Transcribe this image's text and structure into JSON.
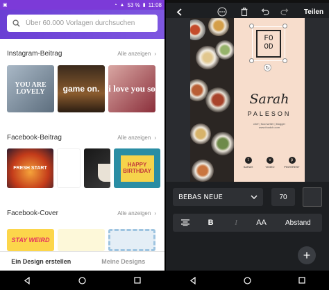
{
  "left_phone": {
    "status": {
      "battery": "53 %",
      "time": "11:08"
    },
    "search": {
      "placeholder": "Über 60.000 Vorlagen durchsuchen"
    },
    "sections": [
      {
        "title": "Instagram-Beitrag",
        "link": "Alle anzeigen",
        "thumbs": [
          "YOU ARE LOVELY",
          "game on.",
          "i love you so"
        ]
      },
      {
        "title": "Facebook-Beitrag",
        "link": "Alle anzeigen",
        "thumbs": [
          "FRESH START",
          "",
          "",
          "HAPPY BIRTHDAY"
        ]
      },
      {
        "title": "Facebook-Cover",
        "link": "Alle anzeigen",
        "thumbs": [
          "STAY WEIRD",
          "",
          ""
        ]
      }
    ],
    "tabs": {
      "create": "Ein Design erstellen",
      "mine": "Meine Designs"
    }
  },
  "right_phone": {
    "toolbar": {
      "share_label": "Teilen"
    },
    "design": {
      "food_line1": "FO",
      "food_line2": "OD",
      "name": "Sarah",
      "surname": "PALESON",
      "tagline": "chef | food writer | blogger",
      "url": "www.foodch.com",
      "social": [
        {
          "icon": "twitter-icon",
          "label": "SARAH",
          "glyph": "t"
        },
        {
          "icon": "vimeo-icon",
          "label": "VIMEO",
          "glyph": "v"
        },
        {
          "icon": "pinterest-icon",
          "label": "PINTEREST",
          "glyph": "p"
        }
      ]
    },
    "font": {
      "family": "BEBAS NEUE",
      "size": "70"
    },
    "format": {
      "bold": "B",
      "italic": "I",
      "caps": "AA",
      "spacing": "Abstand"
    },
    "fab": "+"
  }
}
